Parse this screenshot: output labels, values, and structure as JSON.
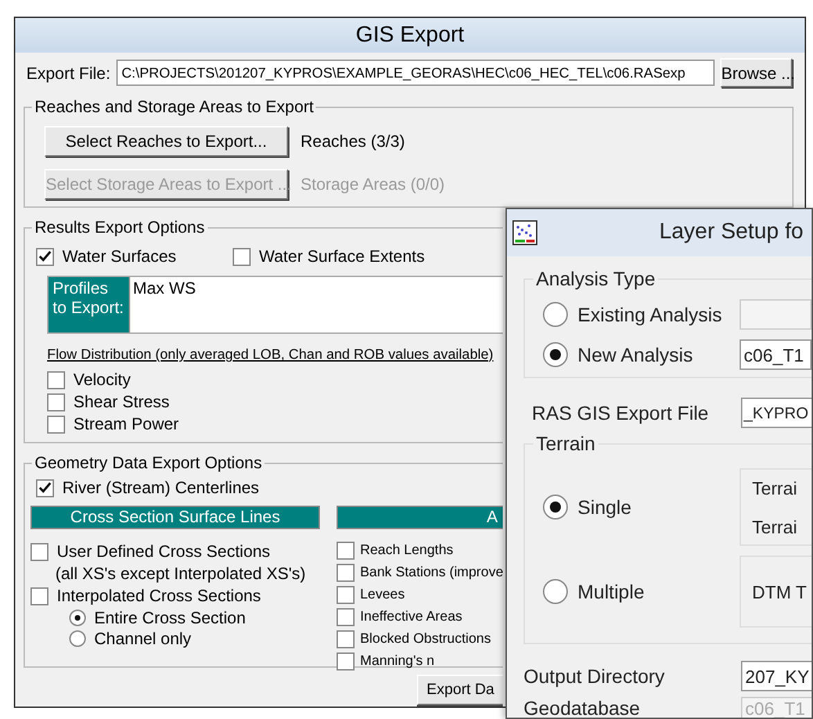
{
  "gis_export": {
    "title": "GIS Export",
    "export_file": {
      "label": "Export File:",
      "value": "C:\\PROJECTS\\201207_KYPROS\\EXAMPLE_GEORAS\\HEC\\c06_HEC_TEL\\c06.RASexp"
    },
    "browse_button": "Browse ...",
    "reaches_group": {
      "title": "Reaches and Storage Areas to Export",
      "rows": [
        {
          "button": "Select Reaches to Export...",
          "status": "Reaches (3/3)",
          "disabled": false
        },
        {
          "button": "Select Storage Areas to Export ...",
          "status": "Storage Areas (0/0)",
          "disabled": true
        }
      ]
    },
    "results_group": {
      "title": "Results Export Options",
      "options": [
        {
          "label": "Water Surfaces",
          "checked": true
        },
        {
          "label": "Water Surface Extents",
          "checked": false
        }
      ],
      "profiles": {
        "label": "Profiles to Export:",
        "items": [
          "Max WS"
        ]
      },
      "flow_distribution": {
        "title": "Flow Distribution (only averaged LOB, Chan and ROB values available)",
        "options": [
          {
            "label": "Velocity",
            "checked": false
          },
          {
            "label": "Shear Stress",
            "checked": false
          },
          {
            "label": "Stream Power",
            "checked": false
          }
        ]
      }
    },
    "geometry_group": {
      "title": "Geometry Data Export Options",
      "centerlines": {
        "label": "River (Stream) Centerlines",
        "checked": true
      },
      "column_1": {
        "heading": "Cross Section Surface Lines",
        "options": [
          {
            "label": "User Defined Cross Sections",
            "note": "(all XS's except Interpolated XS's)",
            "checked": false
          },
          {
            "label": "Interpolated Cross Sections",
            "checked": false
          }
        ],
        "extent": [
          {
            "label": "Entire Cross Section",
            "selected": true
          },
          {
            "label": "Channel only",
            "selected": false
          }
        ]
      },
      "column_2": {
        "heading": "A",
        "options": [
          {
            "label": "Reach Lengths",
            "checked": false
          },
          {
            "label": "Bank Stations (improve",
            "checked": false
          },
          {
            "label": "Levees",
            "checked": false
          },
          {
            "label": "Ineffective Areas",
            "checked": false
          },
          {
            "label": "Blocked Obstructions",
            "checked": false
          },
          {
            "label": "Manning's n",
            "checked": false
          }
        ]
      }
    },
    "export_button": "Export Da"
  },
  "layer_setup": {
    "title": "Layer Setup fo",
    "analysis_type": {
      "title": "Analysis Type",
      "options": [
        {
          "label": "Existing Analysis",
          "selected": false
        },
        {
          "label": "New Analysis",
          "selected": true,
          "value": "c06_T1"
        }
      ]
    },
    "export_file": {
      "label": "RAS GIS Export File",
      "value": "_KYPRO"
    },
    "terrain": {
      "title": "Terrain",
      "options": [
        {
          "label": "Single",
          "selected": true,
          "fields": [
            "Terrai",
            "Terrai"
          ]
        },
        {
          "label": "Multiple",
          "selected": false,
          "fields": [
            "DTM T"
          ]
        }
      ]
    },
    "output_directory": {
      "label": "Output Directory",
      "value": "207_KY"
    },
    "geodatabase": {
      "label": "Geodatabase",
      "value": "c06_T1",
      "disabled": true
    }
  }
}
